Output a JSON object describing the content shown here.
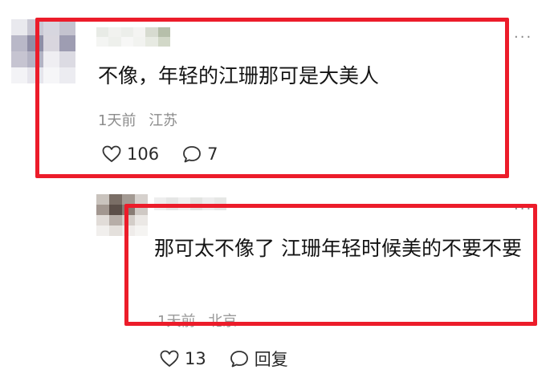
{
  "comment": {
    "text": "不像，年轻的江珊那可是大美人",
    "time": "1天前",
    "location": "江苏",
    "likes": "106",
    "replies": "7",
    "more": "···"
  },
  "reply": {
    "text": "那可太不像了 江珊年轻时候美的不要不要",
    "time": "1天前",
    "location": "北京",
    "likes": "13",
    "reply_label": "回复",
    "more": "···"
  },
  "colors": {
    "highlight": "#ec1c2a",
    "meta_text": "#8c8c8c"
  }
}
